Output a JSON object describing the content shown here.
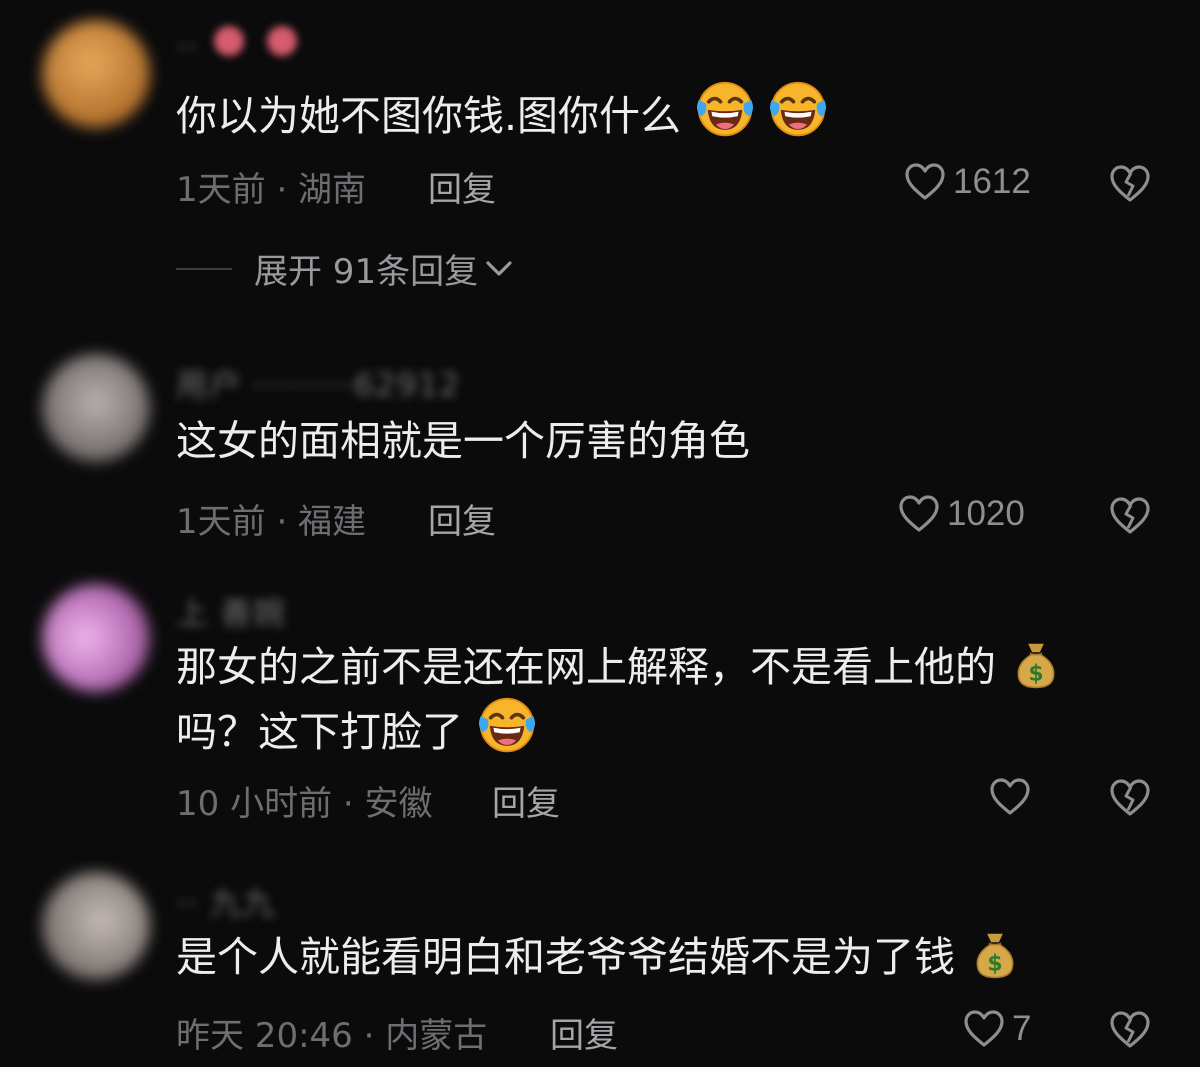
{
  "comments": [
    {
      "username": "·· ",
      "text": "你以为她不图你钱.图你什么",
      "meta": "1天前 · 湖南",
      "reply_label": "回复",
      "likes": "1612",
      "emojis": [
        "rolling-on-floor-laughing",
        "rolling-on-floor-laughing"
      ],
      "avatar_color": "#c98a3a",
      "expand_label": "展开 91条回复"
    },
    {
      "username": "用户 ·········62912",
      "text": "这女的面相就是一个厉害的角色",
      "meta": "1天前 · 福建",
      "reply_label": "回复",
      "likes": "1020",
      "avatar_color": "#8a8588"
    },
    {
      "username": "上 善婉",
      "text_line1": "那女的之前不是还在网上解释，不是看上他的",
      "text_line2": "吗？这下打脸了",
      "meta": "10 小时前 · 安徽",
      "reply_label": "回复",
      "likes": "",
      "emojis": [
        "money-bag",
        "rolling-on-floor-laughing"
      ],
      "avatar_color": "#c77bc4"
    },
    {
      "username": "·· 九九",
      "text": "是个人就能看明白和老爷爷结婚不是为了钱",
      "meta": "昨天 20:46 · 内蒙古",
      "reply_label": "回复",
      "likes": "7",
      "emojis": [
        "money-bag"
      ],
      "avatar_color": "#9a938f"
    }
  ],
  "icons": {
    "like": "heart-outline-icon",
    "dislike": "broken-heart-icon",
    "expand": "chevron-down-icon"
  },
  "colors": {
    "background": "#0b0b0c",
    "text": "#ededed",
    "meta": "#6e6e72",
    "reply": "#a6a6aa"
  }
}
